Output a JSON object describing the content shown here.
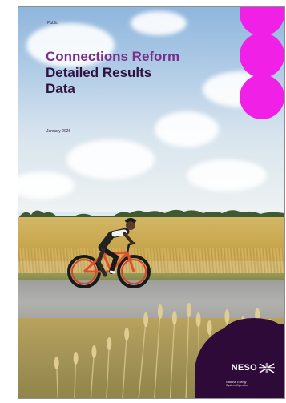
{
  "cover": {
    "classification": "Public",
    "title_line1": "Connections Reform",
    "title_line2": "Detailed Results",
    "title_line3": "Data",
    "date": "January 2026"
  },
  "logo": {
    "name": "NESO",
    "sub_line1": "National Energy",
    "sub_line2": "System Operator",
    "icon": "union-flag-icon"
  },
  "colors": {
    "accent_magenta": "#f020e6",
    "title_purple": "#7a2f8b",
    "title_dark": "#2d1240",
    "logo_bg": "#2e0a38"
  }
}
